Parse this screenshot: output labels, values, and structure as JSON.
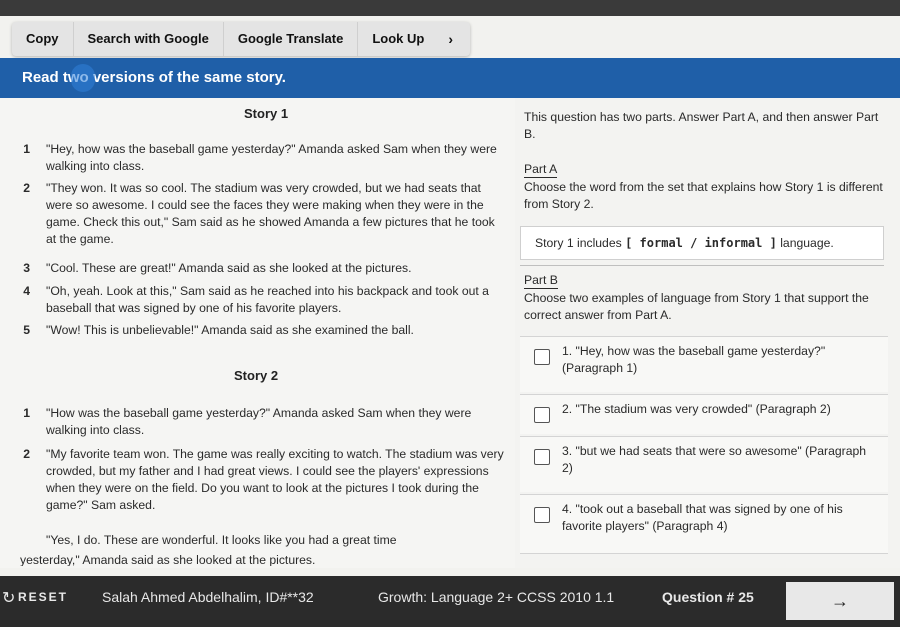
{
  "toolbar": {
    "copy": "Copy",
    "search": "Search with Google",
    "translate": "Google Translate",
    "lookup": "Look Up",
    "more": "›"
  },
  "banner": "Read two versions of the same story.",
  "story1": {
    "title": "Story 1",
    "paragraphs": [
      {
        "num": "1",
        "text": "\"Hey, how was the baseball game yesterday?\" Amanda asked Sam when they were walking into class."
      },
      {
        "num": "2",
        "text": "\"They won. It was so cool. The stadium was very crowded, but we had seats that were so awesome. I could see the faces they were making when they were in the game. Check this out,\" Sam said as he showed Amanda a few pictures that he took at the game."
      },
      {
        "num": "3",
        "text": "\"Cool. These are great!\" Amanda said as she looked at the pictures."
      },
      {
        "num": "4",
        "text": "\"Oh, yeah. Look at this,\" Sam said as he reached into his backpack and took out a baseball that was signed by one of his favorite players."
      },
      {
        "num": "5",
        "text": "\"Wow! This is unbelievable!\" Amanda said as she examined the ball."
      }
    ]
  },
  "story2": {
    "title": "Story 2",
    "paragraphs": [
      {
        "num": "1",
        "text": "\"How was the baseball game yesterday?\" Amanda asked Sam when they were walking into class."
      },
      {
        "num": "2",
        "text": "\"My favorite team won. The game was really exciting to watch. The stadium was very crowded, but my father and I had great views. I could see the players' expressions when they were on the field. Do you want to look at the pictures I took during the game?\" Sam asked."
      },
      {
        "num": "",
        "text": "\"Yes, I do. These are wonderful. It looks like you had a great time"
      },
      {
        "num": "",
        "text": "yesterday,\" Amanda said as she looked at the pictures."
      }
    ]
  },
  "question": {
    "intro": "This question has two parts. Answer Part A, and then answer Part B.",
    "partA_label": "Part A",
    "partA_text": "Choose the word from the set that explains how Story 1 is different from Story 2.",
    "fill_prefix": "Story 1 includes",
    "fill_choice": "[ formal / informal ]",
    "fill_suffix": "language.",
    "partB_label": "Part B",
    "partB_text": "Choose two examples of language from Story 1 that support the correct answer from Part A.",
    "options": [
      "1. \"Hey, how was the baseball game yesterday?\" (Paragraph 1)",
      "2. \"The stadium was very crowded\" (Paragraph 2)",
      "3. \"but we had seats that were so awesome\" (Paragraph 2)",
      "4. \"took out a baseball that was signed by one of his favorite players\" (Paragraph 4)"
    ]
  },
  "footer": {
    "reset": "RESET",
    "student": "Salah Ahmed Abdelhalim, ID#**32",
    "growth": "Growth: Language 2+ CCSS 2010 1.1",
    "question_number": "Question # 25",
    "next": "→"
  }
}
